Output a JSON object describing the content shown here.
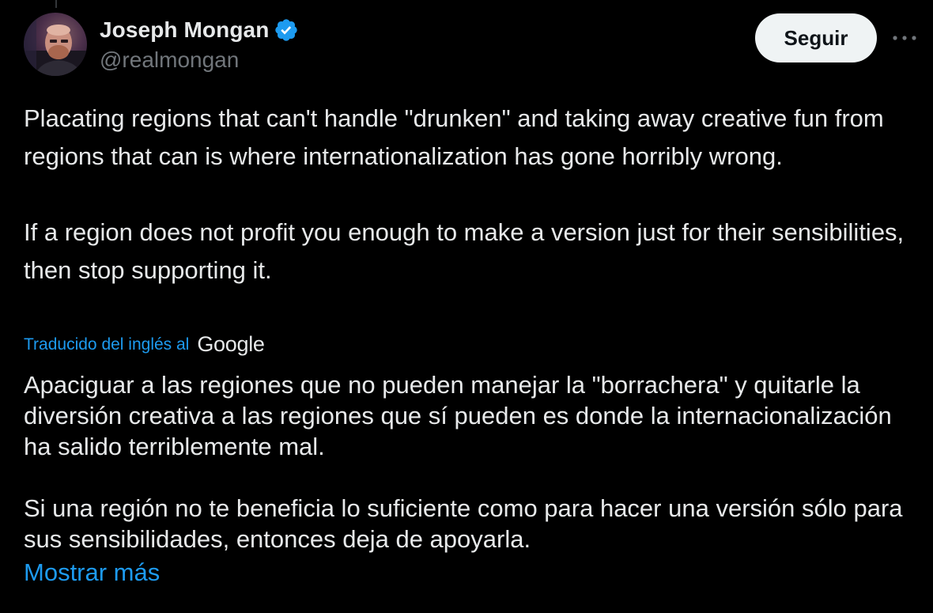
{
  "author": {
    "display_name": "Joseph Mongan",
    "handle": "@realmongan",
    "verified_badge_icon": "verified-check-icon",
    "badge_color": "#1d9bf0"
  },
  "actions": {
    "follow_label": "Seguir",
    "more_icon": "ellipsis-icon"
  },
  "tweet": {
    "paragraphs": [
      "Placating regions that can't handle \"drunken\" and taking away creative fun from regions that can is where internationalization has gone horribly wrong.",
      "If a region does not profit you enough to make a version just for their sensibilities, then stop supporting it."
    ]
  },
  "translation": {
    "label": "Traducido del inglés al",
    "provider": "Google",
    "paragraphs": [
      "Apaciguar a las regiones que no pueden manejar la \"borrachera\" y quitarle la diversión creativa a las regiones que sí pueden es donde la internacionalización ha salido terriblemente mal.",
      "Si una región no te beneficia lo suficiente como para hacer una versión sólo para sus sensibilidades, entonces deja de apoyarla."
    ],
    "show_more_label": "Mostrar más"
  },
  "colors": {
    "background": "#000000",
    "text": "#e7e9ea",
    "secondary_text": "#71767b",
    "link": "#1d9bf0",
    "button_bg": "#eff3f4"
  }
}
